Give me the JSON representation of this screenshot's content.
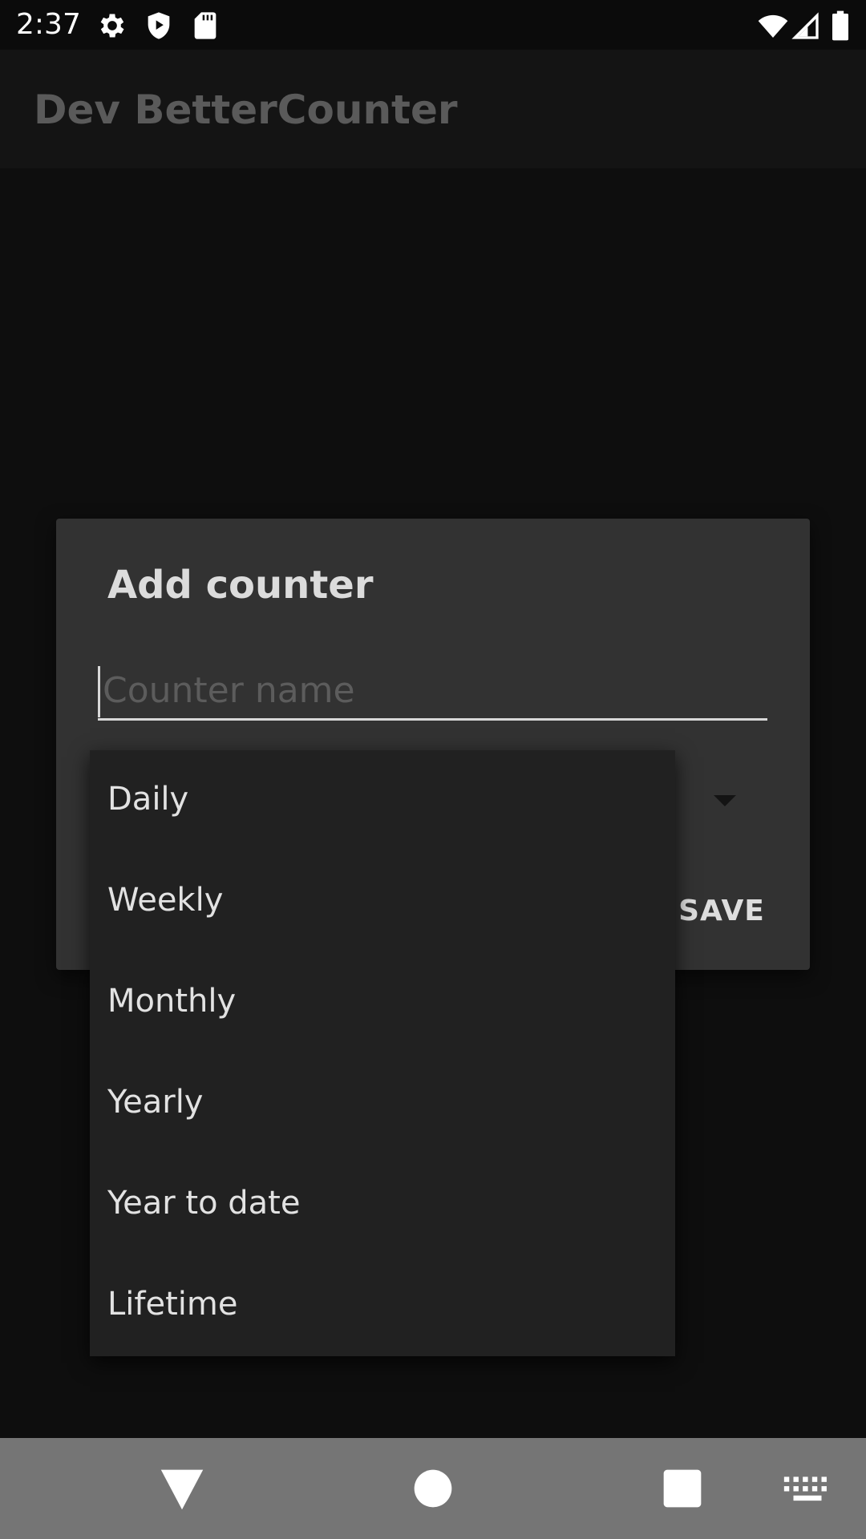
{
  "status_bar": {
    "time": "2:37",
    "left_icons": [
      "gear-icon",
      "shield-play-icon",
      "sd-card-icon"
    ],
    "right_icons": [
      "wifi-icon",
      "cell-signal-icon",
      "battery-icon"
    ]
  },
  "app_bar": {
    "title": "Dev BetterCounter"
  },
  "dialog": {
    "title": "Add counter",
    "name_input": {
      "value": "",
      "placeholder": "Counter name"
    },
    "save_label": "SAVE"
  },
  "dropdown": {
    "items": [
      {
        "label": "Daily"
      },
      {
        "label": "Weekly"
      },
      {
        "label": "Monthly"
      },
      {
        "label": "Yearly"
      },
      {
        "label": "Year to date"
      },
      {
        "label": "Lifetime"
      }
    ]
  },
  "nav_bar": {
    "buttons": [
      "back-icon",
      "home-icon",
      "recents-icon",
      "keyboard-icon"
    ]
  },
  "colors": {
    "background": "#0e0e0e",
    "dialog": "#323232",
    "dropdown": "#212121",
    "nav_bar": "#757575"
  }
}
